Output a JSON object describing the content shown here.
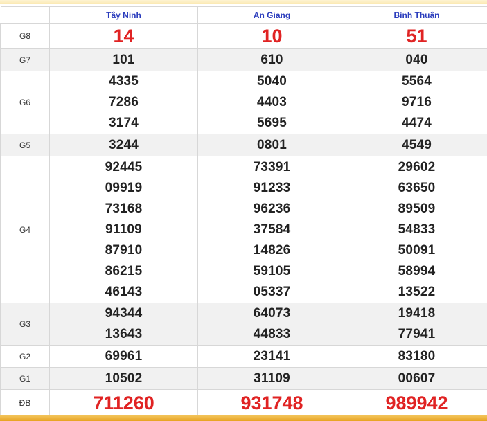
{
  "provinces": [
    "Tây Ninh",
    "An Giang",
    "Bình Thuận"
  ],
  "colors": {
    "header_link": "#2b3dbd",
    "special_red": "#e02323",
    "row_alt": "#f1f1f1",
    "accent_gold": "#e7a322"
  },
  "rows": {
    "g8": {
      "label": "G8",
      "values": [
        "14",
        "10",
        "51"
      ]
    },
    "g7": {
      "label": "G7",
      "values": [
        "101",
        "610",
        "040"
      ]
    },
    "g6": {
      "label": "G6",
      "values": [
        [
          "4335",
          "7286",
          "3174"
        ],
        [
          "5040",
          "4403",
          "5695"
        ],
        [
          "5564",
          "9716",
          "4474"
        ]
      ]
    },
    "g5": {
      "label": "G5",
      "values": [
        "3244",
        "0801",
        "4549"
      ]
    },
    "g4": {
      "label": "G4",
      "values": [
        [
          "92445",
          "09919",
          "73168",
          "91109",
          "87910",
          "86215",
          "46143"
        ],
        [
          "73391",
          "91233",
          "96236",
          "37584",
          "14826",
          "59105",
          "05337"
        ],
        [
          "29602",
          "63650",
          "89509",
          "54833",
          "50091",
          "58994",
          "13522"
        ]
      ]
    },
    "g3": {
      "label": "G3",
      "values": [
        [
          "94344",
          "13643"
        ],
        [
          "64073",
          "44833"
        ],
        [
          "19418",
          "77941"
        ]
      ]
    },
    "g2": {
      "label": "G2",
      "values": [
        "69961",
        "23141",
        "83180"
      ]
    },
    "g1": {
      "label": "G1",
      "values": [
        "10502",
        "31109",
        "00607"
      ]
    },
    "db": {
      "label": "ĐB",
      "values": [
        "711260",
        "931748",
        "989942"
      ]
    }
  }
}
